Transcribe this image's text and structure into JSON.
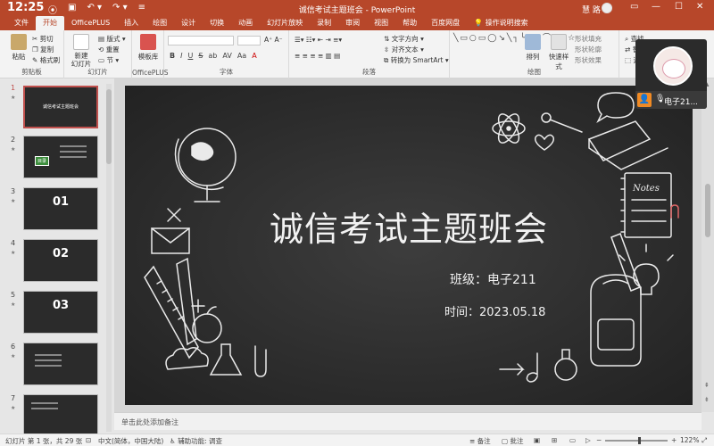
{
  "titlebar": {
    "clock": "12:25",
    "doc_title": "诚信考试主题班会 - PowerPoint",
    "user_name": "慧 路",
    "win_min": "—",
    "win_max": "☐",
    "win_close": "✕"
  },
  "tabs": [
    "文件",
    "开始",
    "OfficePLUS",
    "插入",
    "绘图",
    "设计",
    "切换",
    "动画",
    "幻灯片放映",
    "录制",
    "审阅",
    "视图",
    "帮助",
    "百度网盘",
    "操作说明搜索"
  ],
  "active_tab": "开始",
  "ribbon": {
    "clipboard": {
      "label": "剪贴板",
      "paste": "粘贴",
      "cut": "剪切",
      "copy": "复制",
      "format_painter": "格式刷"
    },
    "slides": {
      "label": "幻灯片",
      "new_slide": "新建\n幻灯片",
      "layout": "版式",
      "reset": "重置",
      "section": "节"
    },
    "officeplus": {
      "label": "OfficePLUS",
      "template": "模板库"
    },
    "font": {
      "label": "字体",
      "bold": "B",
      "italic": "I",
      "underline": "U",
      "strike": "S",
      "shadow": "ab",
      "spacing": "AV",
      "case": "Aa",
      "color": "A"
    },
    "paragraph": {
      "label": "段落",
      "text_direction": "文字方向",
      "align_text": "对齐文本",
      "smartart": "转换为 SmartArt"
    },
    "drawing": {
      "label": "绘图",
      "arrange": "排列",
      "quick_styles": "快速样式",
      "fill": "形状填充",
      "outline": "形状轮廓",
      "effect": "形状效果"
    },
    "editing": {
      "find": "查找",
      "replace": "替换",
      "select": "选择"
    }
  },
  "thumbnails": [
    {
      "num": "1",
      "title": "诚信考试主题班会",
      "selected": true
    },
    {
      "num": "2",
      "title": "目录"
    },
    {
      "num": "3",
      "title": "01"
    },
    {
      "num": "4",
      "title": "02"
    },
    {
      "num": "5",
      "title": "03"
    },
    {
      "num": "6",
      "title": ""
    },
    {
      "num": "7",
      "title": ""
    }
  ],
  "slide": {
    "title": "诚信考试主题班会",
    "class_line": "班级：电子211",
    "date_line": "时间：2023.05.18",
    "notebook_text": "Notes"
  },
  "notes_placeholder": "单击此处添加备注",
  "status": {
    "slide_info": "幻灯片 第 1 张，共 29 张",
    "language": "中文(简体，中国大陆)",
    "accessibility": "辅助功能: 调查",
    "notes_btn": "备注",
    "comments_btn": "批注",
    "zoom": "122%"
  },
  "meeting": {
    "name": "电子21..."
  }
}
